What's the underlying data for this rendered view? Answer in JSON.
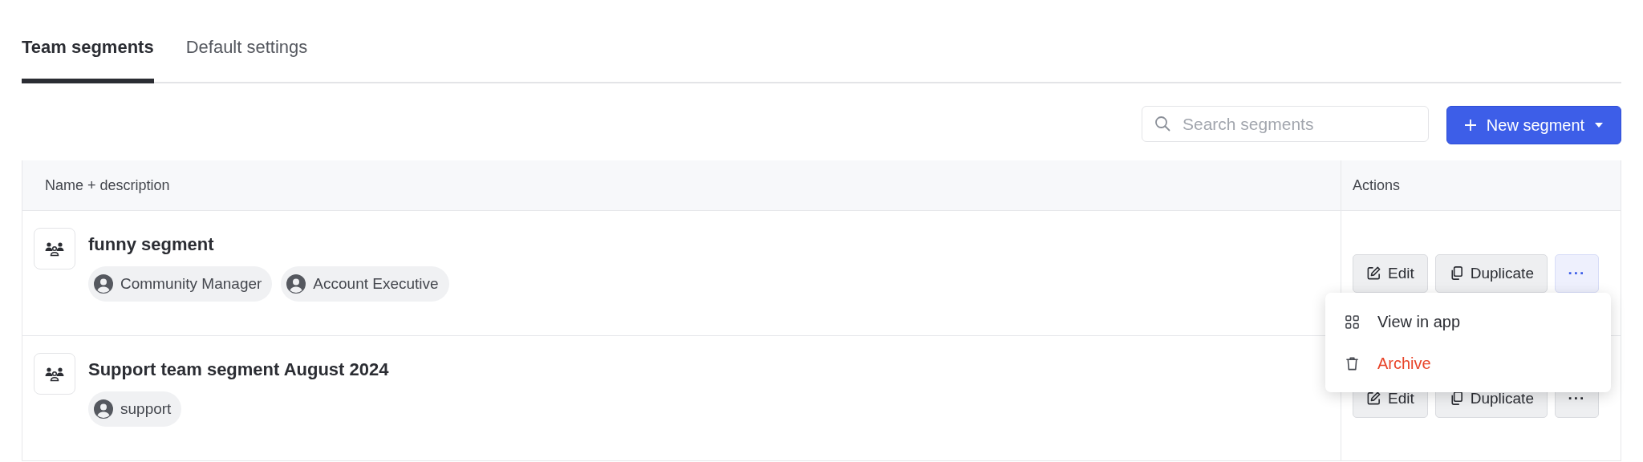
{
  "tabs": [
    {
      "label": "Team segments",
      "selected": true
    },
    {
      "label": "Default settings",
      "selected": false
    }
  ],
  "search": {
    "placeholder": "Search segments"
  },
  "new_button": {
    "label": "New segment"
  },
  "table": {
    "columns": [
      "Name + description",
      "Actions"
    ],
    "rows": [
      {
        "name": "funny segment",
        "tags": [
          "Community Manager",
          "Account Executive"
        ],
        "actions": {
          "edit": "Edit",
          "duplicate": "Duplicate",
          "more": "···"
        },
        "menu_open": true
      },
      {
        "name": "Support team segment August 2024",
        "tags": [
          "support"
        ],
        "actions": {
          "edit": "Edit",
          "duplicate": "Duplicate",
          "more": "···"
        },
        "menu_open": false
      }
    ]
  },
  "menu": {
    "items": [
      {
        "label": "View in app",
        "kind": "apps"
      },
      {
        "label": "Archive",
        "kind": "danger"
      }
    ]
  }
}
